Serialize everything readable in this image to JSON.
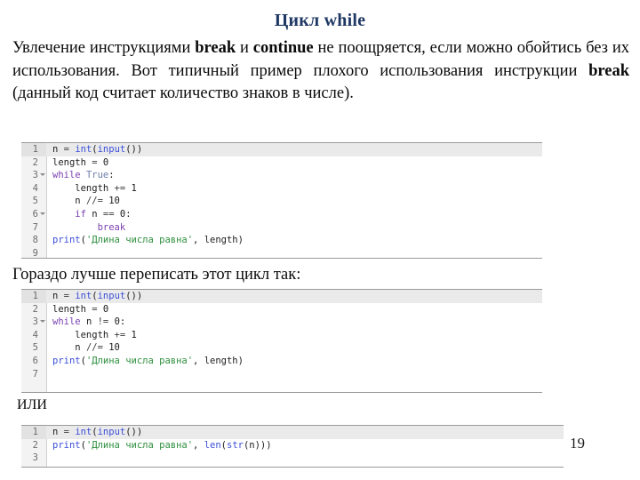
{
  "slide": {
    "title": "Цикл while",
    "number": "19",
    "title_color": "#1F3864",
    "background": "#ffffff",
    "paragraph": {
      "segments": [
        {
          "text": "Увлечение инструкциями ",
          "bold": false
        },
        {
          "text": "break",
          "bold": true
        },
        {
          "text": " и ",
          "bold": false
        },
        {
          "text": "continue",
          "bold": true
        },
        {
          "text": " не поощряется, если можно обойтись без их использования. Вот типичный пример плохого использования инструкции ",
          "bold": false
        },
        {
          "text": "break",
          "bold": true
        },
        {
          "text": " (данный код считает количество знаков в числе).",
          "bold": false
        }
      ]
    },
    "subhead_1": "Гораздо лучше переписать этот цикл так:",
    "subhead_2": "ИЛИ"
  },
  "code_blocks": [
    {
      "id": "code-1",
      "lines": [
        {
          "num": "1",
          "fold": false,
          "highlight": true,
          "tokens": [
            {
              "t": "n ",
              "c": "plain"
            },
            {
              "t": "= ",
              "c": "op"
            },
            {
              "t": "int",
              "c": "fn"
            },
            {
              "t": "(",
              "c": "plain"
            },
            {
              "t": "input",
              "c": "fn"
            },
            {
              "t": "())",
              "c": "plain"
            }
          ]
        },
        {
          "num": "2",
          "fold": false,
          "highlight": false,
          "tokens": [
            {
              "t": "length ",
              "c": "plain"
            },
            {
              "t": "= ",
              "c": "op"
            },
            {
              "t": "0",
              "c": "num"
            }
          ]
        },
        {
          "num": "3",
          "fold": true,
          "highlight": false,
          "tokens": [
            {
              "t": "while ",
              "c": "kw"
            },
            {
              "t": "True",
              "c": "bi"
            },
            {
              "t": ":",
              "c": "plain"
            }
          ]
        },
        {
          "num": "4",
          "fold": false,
          "highlight": false,
          "tokens": [
            {
              "t": "    length ",
              "c": "plain"
            },
            {
              "t": "+= ",
              "c": "op"
            },
            {
              "t": "1",
              "c": "num"
            }
          ]
        },
        {
          "num": "5",
          "fold": false,
          "highlight": false,
          "tokens": [
            {
              "t": "    n ",
              "c": "plain"
            },
            {
              "t": "//= ",
              "c": "op"
            },
            {
              "t": "10",
              "c": "num"
            }
          ]
        },
        {
          "num": "6",
          "fold": true,
          "highlight": false,
          "tokens": [
            {
              "t": "    ",
              "c": "plain"
            },
            {
              "t": "if ",
              "c": "kw"
            },
            {
              "t": "n ",
              "c": "plain"
            },
            {
              "t": "== ",
              "c": "op"
            },
            {
              "t": "0",
              "c": "num"
            },
            {
              "t": ":",
              "c": "plain"
            }
          ]
        },
        {
          "num": "7",
          "fold": false,
          "highlight": false,
          "tokens": [
            {
              "t": "        ",
              "c": "plain"
            },
            {
              "t": "break",
              "c": "brk"
            }
          ]
        },
        {
          "num": "8",
          "fold": false,
          "highlight": false,
          "tokens": [
            {
              "t": "print",
              "c": "fn"
            },
            {
              "t": "(",
              "c": "plain"
            },
            {
              "t": "'Длина числа равна'",
              "c": "str"
            },
            {
              "t": ", length)",
              "c": "plain"
            }
          ]
        },
        {
          "num": "9",
          "fold": false,
          "highlight": false,
          "tokens": []
        }
      ]
    },
    {
      "id": "code-2",
      "lines": [
        {
          "num": "1",
          "fold": false,
          "highlight": true,
          "tokens": [
            {
              "t": "n ",
              "c": "plain"
            },
            {
              "t": "= ",
              "c": "op"
            },
            {
              "t": "int",
              "c": "fn"
            },
            {
              "t": "(",
              "c": "plain"
            },
            {
              "t": "input",
              "c": "fn"
            },
            {
              "t": "())",
              "c": "plain"
            }
          ]
        },
        {
          "num": "2",
          "fold": false,
          "highlight": false,
          "tokens": [
            {
              "t": "length ",
              "c": "plain"
            },
            {
              "t": "= ",
              "c": "op"
            },
            {
              "t": "0",
              "c": "num"
            }
          ]
        },
        {
          "num": "3",
          "fold": true,
          "highlight": false,
          "tokens": [
            {
              "t": "while ",
              "c": "kw"
            },
            {
              "t": "n ",
              "c": "plain"
            },
            {
              "t": "!= ",
              "c": "op"
            },
            {
              "t": "0",
              "c": "num"
            },
            {
              "t": ":",
              "c": "plain"
            }
          ]
        },
        {
          "num": "4",
          "fold": false,
          "highlight": false,
          "tokens": [
            {
              "t": "    length ",
              "c": "plain"
            },
            {
              "t": "+= ",
              "c": "op"
            },
            {
              "t": "1",
              "c": "num"
            }
          ]
        },
        {
          "num": "5",
          "fold": false,
          "highlight": false,
          "tokens": [
            {
              "t": "    n ",
              "c": "plain"
            },
            {
              "t": "//= ",
              "c": "op"
            },
            {
              "t": "10",
              "c": "num"
            }
          ]
        },
        {
          "num": "6",
          "fold": false,
          "highlight": false,
          "tokens": [
            {
              "t": "print",
              "c": "fn"
            },
            {
              "t": "(",
              "c": "plain"
            },
            {
              "t": "'Длина числа равна'",
              "c": "str"
            },
            {
              "t": ", length)",
              "c": "plain"
            }
          ]
        },
        {
          "num": "7",
          "fold": false,
          "highlight": false,
          "tokens": []
        }
      ]
    },
    {
      "id": "code-3",
      "lines": [
        {
          "num": "1",
          "fold": false,
          "highlight": true,
          "tokens": [
            {
              "t": "n ",
              "c": "plain"
            },
            {
              "t": "= ",
              "c": "op"
            },
            {
              "t": "int",
              "c": "fn"
            },
            {
              "t": "(",
              "c": "plain"
            },
            {
              "t": "input",
              "c": "fn"
            },
            {
              "t": "())",
              "c": "plain"
            }
          ]
        },
        {
          "num": "2",
          "fold": false,
          "highlight": false,
          "tokens": [
            {
              "t": "print",
              "c": "fn"
            },
            {
              "t": "(",
              "c": "plain"
            },
            {
              "t": "'Длина числа равна'",
              "c": "str"
            },
            {
              "t": ", ",
              "c": "plain"
            },
            {
              "t": "len",
              "c": "fn"
            },
            {
              "t": "(",
              "c": "plain"
            },
            {
              "t": "str",
              "c": "fn"
            },
            {
              "t": "(n)))",
              "c": "plain"
            }
          ]
        },
        {
          "num": "3",
          "fold": false,
          "highlight": false,
          "tokens": []
        }
      ]
    }
  ],
  "syntax_colors": {
    "keyword": "#7a3fb0",
    "builtin": "#6b7ea8",
    "function": "#3b4fd8",
    "string": "#2f8f3f",
    "plain": "#202020",
    "gutter": "#6c6c6c",
    "highlight_bg": "#eaeaea"
  }
}
